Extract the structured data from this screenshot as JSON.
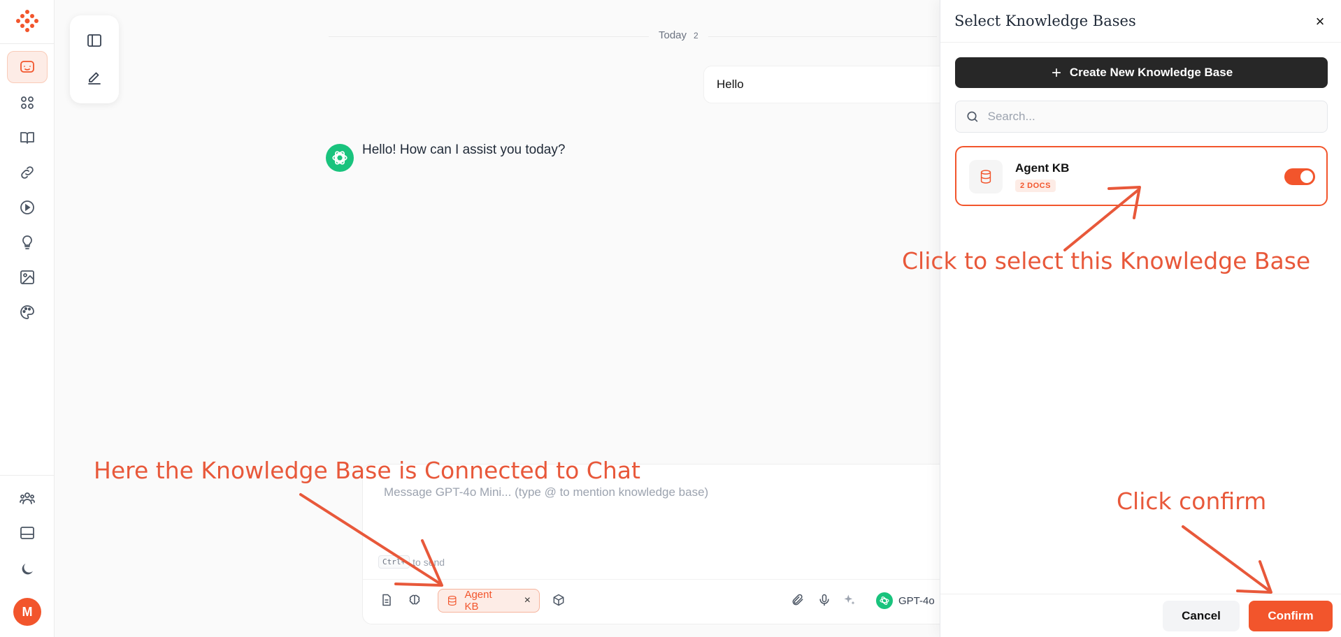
{
  "chat": {
    "day_label": "Today",
    "day_count": "2",
    "user_message": "Hello",
    "assistant_message": "Hello! How can I assist you today?"
  },
  "composer": {
    "placeholder": "Message GPT-4o Mini... (type @ to mention knowledge base)",
    "hint_key": "Ctrl+",
    "hint_text": "to send",
    "kb_chip_label": "Agent KB",
    "kb_chip_remove": "×",
    "model_label": "GPT-4o"
  },
  "rail": {
    "avatar_initial": "M"
  },
  "panel": {
    "title": "Select Knowledge Bases",
    "close_glyph": "×",
    "create_button_label": "Create New Knowledge Base",
    "search_placeholder": "Search...",
    "knowledge_bases": [
      {
        "name": "Agent KB",
        "docs": "2 DOCS",
        "selected": true
      }
    ],
    "cancel_label": "Cancel",
    "confirm_label": "Confirm"
  },
  "annotations": {
    "select_kb": "Click to select this Knowledge Base",
    "kb_connected": "Here the Knowledge Base is Connected to Chat",
    "click_confirm": "Click confirm"
  },
  "colors": {
    "accent": "#f2552c",
    "annotation": "#e8583a",
    "assistant_avatar": "#19c37d",
    "create_button": "#272727"
  },
  "icons": {
    "rail": [
      "logo-icon",
      "chat-icon",
      "apps-icon",
      "book-icon",
      "link-icon",
      "play-icon",
      "lightbulb-icon",
      "image-icon",
      "palette-icon",
      "users-icon",
      "layout-icon",
      "moon-icon"
    ],
    "float_tools": [
      "sidebar-toggle-icon",
      "edit-icon"
    ],
    "composer": [
      "document-icon",
      "brain-icon",
      "database-icon",
      "cube-icon",
      "paperclip-icon",
      "microphone-icon",
      "sparkles-icon",
      "openai-icon"
    ]
  }
}
